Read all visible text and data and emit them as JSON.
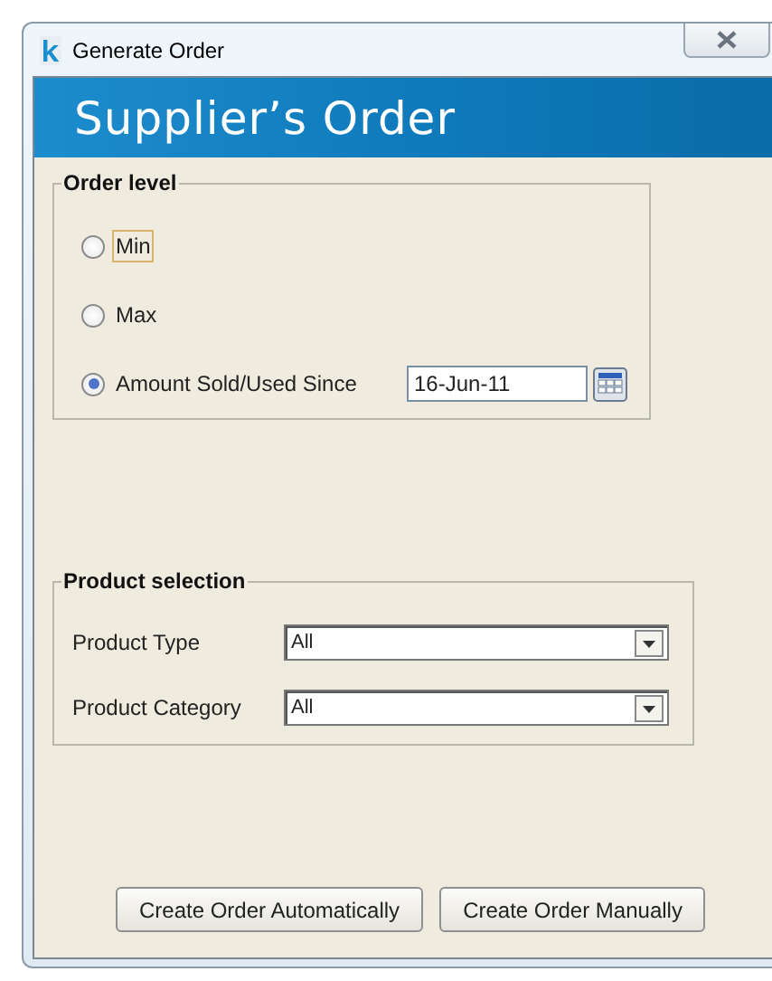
{
  "window": {
    "title": "Generate Order"
  },
  "header": {
    "title": "Supplier’s Order"
  },
  "order_level": {
    "legend": "Order level",
    "options": [
      {
        "label": "Min",
        "selected": false,
        "focused": true
      },
      {
        "label": "Max",
        "selected": false,
        "focused": false
      },
      {
        "label": "Amount Sold/Used Since",
        "selected": true,
        "focused": false,
        "date": "16-Jun-11"
      }
    ]
  },
  "product_selection": {
    "legend": "Product selection",
    "fields": [
      {
        "label": "Product Type",
        "value": "All"
      },
      {
        "label": "Product Category",
        "value": "All"
      }
    ]
  },
  "buttons": [
    "Create Order Automatically",
    "Create Order Manually"
  ]
}
